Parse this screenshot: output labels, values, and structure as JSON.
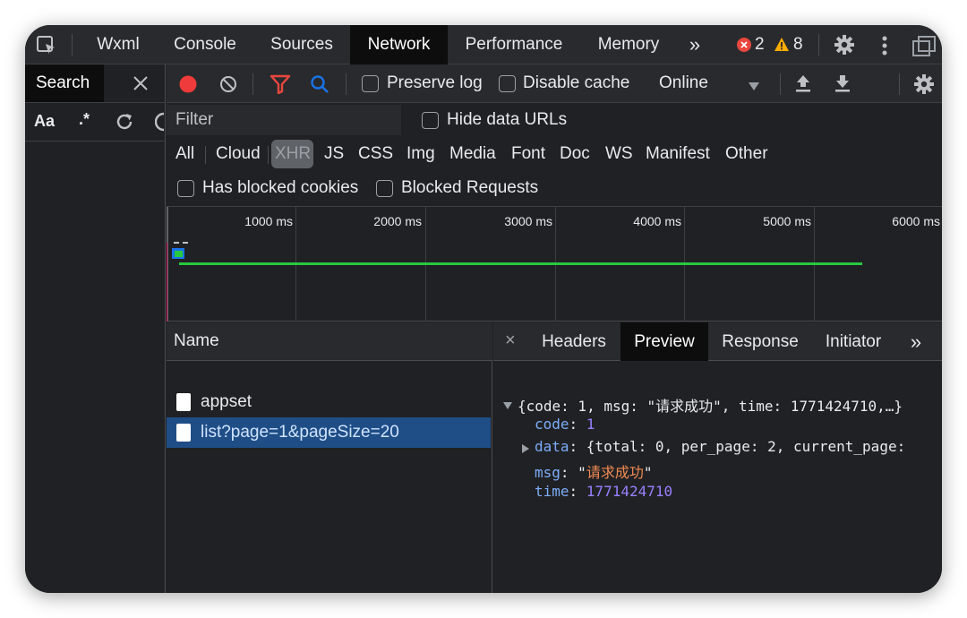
{
  "topbar": {
    "tabs": [
      "Wxml",
      "Console",
      "Sources",
      "Network",
      "Performance",
      "Memory"
    ],
    "more": "»",
    "errors": "2",
    "warnings": "8"
  },
  "search": {
    "tab_label": "Search",
    "case_label": "Aa",
    "regex_label": ".*"
  },
  "toolbar": {
    "preserve_log": "Preserve log",
    "disable_cache": "Disable cache",
    "throttle": "Online"
  },
  "filter": {
    "placeholder": "Filter",
    "hide_data_urls": "Hide data URLs",
    "types": [
      "All",
      "Cloud",
      "XHR",
      "JS",
      "CSS",
      "Img",
      "Media",
      "Font",
      "Doc",
      "WS",
      "Manifest",
      "Other"
    ],
    "active_type": "XHR",
    "has_blocked_cookies": "Has blocked cookies",
    "blocked_requests": "Blocked Requests"
  },
  "overview": {
    "ticks": [
      "1000 ms",
      "2000 ms",
      "3000 ms",
      "4000 ms",
      "5000 ms",
      "6000 ms"
    ]
  },
  "requests": {
    "header": "Name",
    "rows": [
      "appset",
      "list?page=1&pageSize=20"
    ],
    "selected": 1
  },
  "detail": {
    "close": "×",
    "tabs": [
      "Headers",
      "Preview",
      "Response",
      "Initiator"
    ],
    "active_tab": "Preview",
    "more": "»",
    "summary": "{code: 1, msg: \"请求成功\", time: 1771424710,…}",
    "code_key": "code",
    "code_val": "1",
    "data_key": "data",
    "data_val": "{total: 0, per_page: 2, current_page:",
    "msg_key": "msg",
    "msg_val": "请求成功",
    "time_key": "time",
    "time_val": "1771424710"
  },
  "colors": {
    "record": "#ef3b3b",
    "filter_icon": "#e8473e",
    "search_icon": "#1a73e8",
    "timeline_bar": "#27c93f",
    "error_badge": "#e8473e",
    "warning_badge": "#f9ab00"
  }
}
